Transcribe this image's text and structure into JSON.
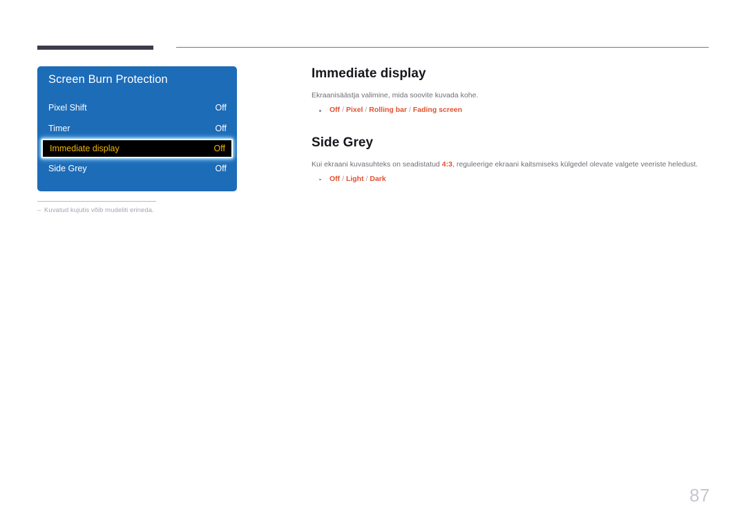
{
  "page": {
    "number": "87",
    "language_note": "Kuvatud kujutis võib mudeliti erineda.",
    "note_dash": "‒"
  },
  "osd_menu": {
    "title": "Screen Burn Protection",
    "accent_color": "#1c6cb8",
    "highlight_text_color": "#f2b705",
    "highlight_bg_color": "#000000",
    "items": [
      {
        "label": "Pixel Shift",
        "value": "Off",
        "selected": false
      },
      {
        "label": "Timer",
        "value": "Off",
        "selected": false
      },
      {
        "label": "Immediate display",
        "value": "Off",
        "selected": true
      },
      {
        "label": "Side Grey",
        "value": "Off",
        "selected": false
      }
    ]
  },
  "sections": [
    {
      "heading": "Immediate display",
      "body_prefix": "Ekraanisäästja valimine, mida soovite kuvada kohe.",
      "body_highlight": "",
      "body_suffix": "",
      "options": [
        "Off",
        "Pixel",
        "Rolling bar",
        "Fading screen"
      ],
      "option_separator": " / "
    },
    {
      "heading": "Side Grey",
      "body_prefix": "Kui ekraani kuvasuhteks on seadistatud ",
      "body_highlight": "4:3",
      "body_suffix": ", reguleerige ekraani kaitsmiseks külgedel olevate valgete veeriste heledust.",
      "options": [
        "Off",
        "Light",
        "Dark"
      ],
      "option_separator": " / "
    }
  ],
  "colors": {
    "option_orange": "#e0512f",
    "heading_dark": "#17161c",
    "body_grey": "#6f6e78",
    "rule_dark": "#3f3a4a",
    "rule_thin": "#76767a",
    "page_number": "#c6c5d0"
  }
}
